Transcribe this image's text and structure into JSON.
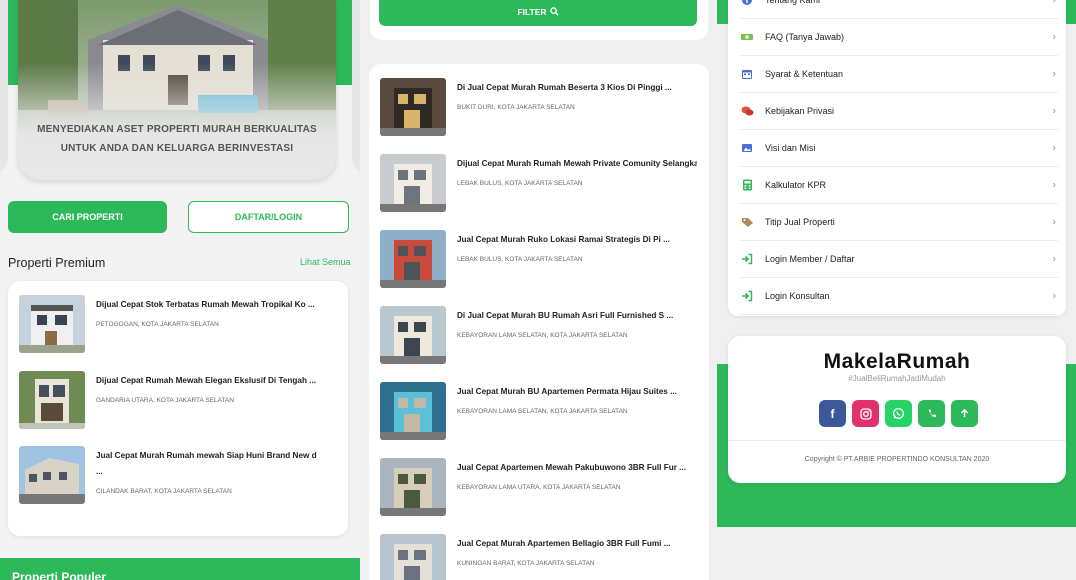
{
  "left_panel": {
    "hero_line1": "MENYEDIAKAN ASET PROPERTI MURAH BERKUALITAS",
    "hero_line2": "UNTUK ANDA DAN KELUARGA BERINVESTASI",
    "search_button": "CARI PROPERTI",
    "login_button": "DAFTAR/LOGIN",
    "premium_title": "Properti Premium",
    "see_all": "Lihat Semua",
    "premium_items": [
      {
        "title": "Dijual Cepat Stok Terbatas Rumah Mewah Tropikal Ko ...",
        "location": "PETOGOGAN, KOTA JAKARTA SELATAN"
      },
      {
        "title": "Dijual Cepat Rumah Mewah Elegan Ekslusif Di Tengah ...",
        "location": "GANDARIA UTARA, KOTA JAKARTA SELATAN"
      },
      {
        "title": "Jual Cepat Murah Rumah mewah Siap Huni Brand New d",
        "title2": "...",
        "location": "CILANDAK BARAT, KOTA JAKARTA SELATAN"
      }
    ],
    "popular_title": "Properti Populer"
  },
  "middle_panel": {
    "filter_button": "FILTER",
    "results": [
      {
        "title": "Di Jual Cepat Murah Rumah Beserta 3 Kios Di Pinggi ...",
        "location": "BUKIT DURI, KOTA JAKARTA SELATAN"
      },
      {
        "title": "Dijual Cepat Murah Rumah Mewah Private Comunity Selangka ...",
        "location": "LEBAK BULUS, KOTA JAKARTA SELATAN"
      },
      {
        "title": "Jual Cepat Murah Ruko Lokasi Ramai Strategis Di Pi ...",
        "location": "LEBAK BULUS, KOTA JAKARTA SELATAN"
      },
      {
        "title": "Di Jual Cepat Murah BU Rumah Asri Full Furnished S ...",
        "location": "KEBAYORAN LAMA SELATAN, KOTA JAKARTA SELATAN"
      },
      {
        "title": "Jual Cepat Murah BU Apartemen Permata Hijau Suites ...",
        "location": "KEBAYORAN LAMA SELATAN, KOTA JAKARTA SELATAN"
      },
      {
        "title": "Jual Cepat Apartemen Mewah Pakubuwono 3BR Full Fur ...",
        "location": "KEBAYORAN LAMA UTARA, KOTA JAKARTA SELATAN"
      },
      {
        "title": "Jual Cepat Murah Apartemen Bellagio 3BR Full Fumi ...",
        "location": "KUNINGAN BARAT, KOTA JAKARTA SELATAN"
      }
    ]
  },
  "right_panel": {
    "menu": [
      {
        "label": "Tentang Kami",
        "icon": "info-icon"
      },
      {
        "label": "FAQ (Tanya Jawab)",
        "icon": "faq-icon"
      },
      {
        "label": "Syarat & Ketentuan",
        "icon": "calendar-icon"
      },
      {
        "label": "Kebijakan Privasi",
        "icon": "chat-icon"
      },
      {
        "label": "Visi dan Misi",
        "icon": "image-icon"
      },
      {
        "label": "Kalkulator KPR",
        "icon": "calculator-icon"
      },
      {
        "label": "Titip Jual Properti",
        "icon": "tag-icon"
      },
      {
        "label": "Login Member / Daftar",
        "icon": "login-icon"
      },
      {
        "label": "Login Konsultan",
        "icon": "login-icon"
      }
    ],
    "brand_name": "MakelaRumah",
    "brand_tagline": "#JualBeliRumahJadiMudah",
    "copyright": "Copyright © PT.ARBIE PROPERTINDO KONSULTAN 2020"
  },
  "colors": {
    "accent": "#2db85a",
    "facebook": "#3b5998",
    "instagram": "#e1306c",
    "whatsapp": "#25d366",
    "phone": "#2db85a",
    "top": "#2db85a"
  }
}
